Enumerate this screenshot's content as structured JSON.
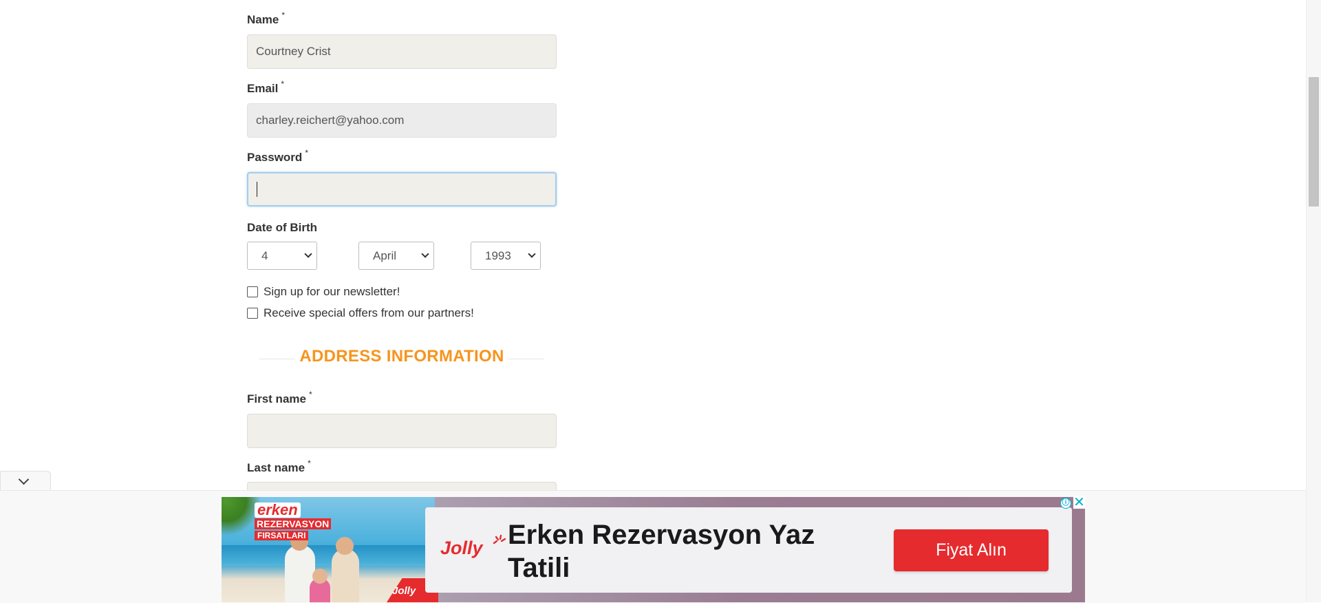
{
  "form": {
    "name": {
      "label": "Name",
      "required": "*",
      "value": "Courtney Crist"
    },
    "email": {
      "label": "Email",
      "required": "*",
      "value": "charley.reichert@yahoo.com"
    },
    "password": {
      "label": "Password",
      "required": "*",
      "value": ""
    },
    "dob": {
      "label": "Date of Birth",
      "day": "4",
      "month": "April",
      "year": "1993"
    },
    "newsletter": {
      "label": "Sign up for our newsletter!",
      "checked": false
    },
    "offers": {
      "label": "Receive special offers from our partners!",
      "checked": false
    },
    "address_section": {
      "title": "ADDRESS INFORMATION"
    },
    "first_name": {
      "label": "First name",
      "required": "*",
      "value": ""
    },
    "last_name": {
      "label": "Last name",
      "required": "*",
      "value": ""
    }
  },
  "ad": {
    "badge_line1": "erken",
    "badge_line2": "REZERVASYON",
    "badge_line3": "FIRSATLARI",
    "brand_small": "Jolly",
    "brand": "Jolly",
    "headline": "Erken Rezervasyon Yaz Tatili",
    "cta": "Fiyat Alın",
    "info_icon": "ⓘ",
    "close_icon": "✕"
  },
  "colors": {
    "accent_orange": "#f7941d",
    "ad_red": "#e52b2e",
    "input_bg": "#f0efea",
    "info_cyan": "#00aecd"
  }
}
